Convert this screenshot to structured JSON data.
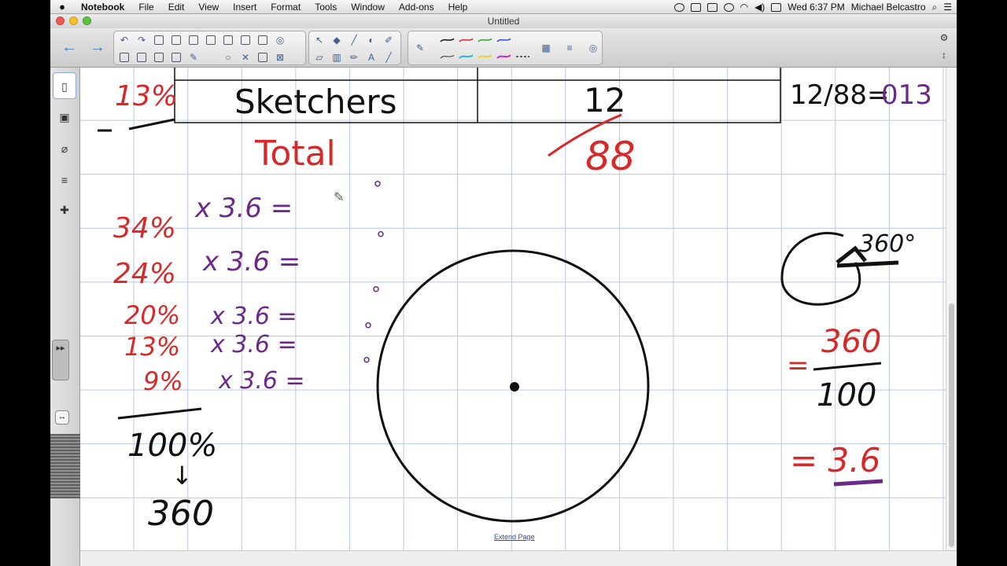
{
  "menubar": {
    "apple": "",
    "items": [
      "Notebook",
      "File",
      "Edit",
      "View",
      "Insert",
      "Format",
      "Tools",
      "Window",
      "Add-ons",
      "Help"
    ],
    "clock": "Wed 6:37 PM",
    "user": "Michael Belcastro"
  },
  "window": {
    "title": "Untitled"
  },
  "canvas": {
    "table_cell_brand": "Sketchers",
    "table_cell_count": "12",
    "total_label": "Total",
    "total_value": "88",
    "top_left_percent": "13%",
    "fraction_note": "12/88=",
    "fraction_result": "013",
    "rows": [
      {
        "percent": "34%",
        "mult": "x 3.6 ="
      },
      {
        "percent": "24%",
        "mult": "x 3.6 ="
      },
      {
        "percent": "20%",
        "mult": "x 3.6 ="
      },
      {
        "percent": "13%",
        "mult": "x 3.6 ="
      },
      {
        "percent": "9%",
        "mult": "x 3.6 ="
      }
    ],
    "sum_percent": "100%",
    "arrow": "↓",
    "sum_degrees": "360",
    "circle_degrees": "360°",
    "eq1_num": "360",
    "eq1_den": "100",
    "eq1_sign": "=",
    "eq2": "= 3.6",
    "degree_marks": [
      "°",
      "°",
      "°",
      "°",
      "°"
    ]
  },
  "extend_page": "Extend Page",
  "colors": {
    "red_ink": "#d42a2a",
    "purple_ink": "#6b2a8a",
    "black_ink": "#111111",
    "grid": "#b8c9e6"
  }
}
